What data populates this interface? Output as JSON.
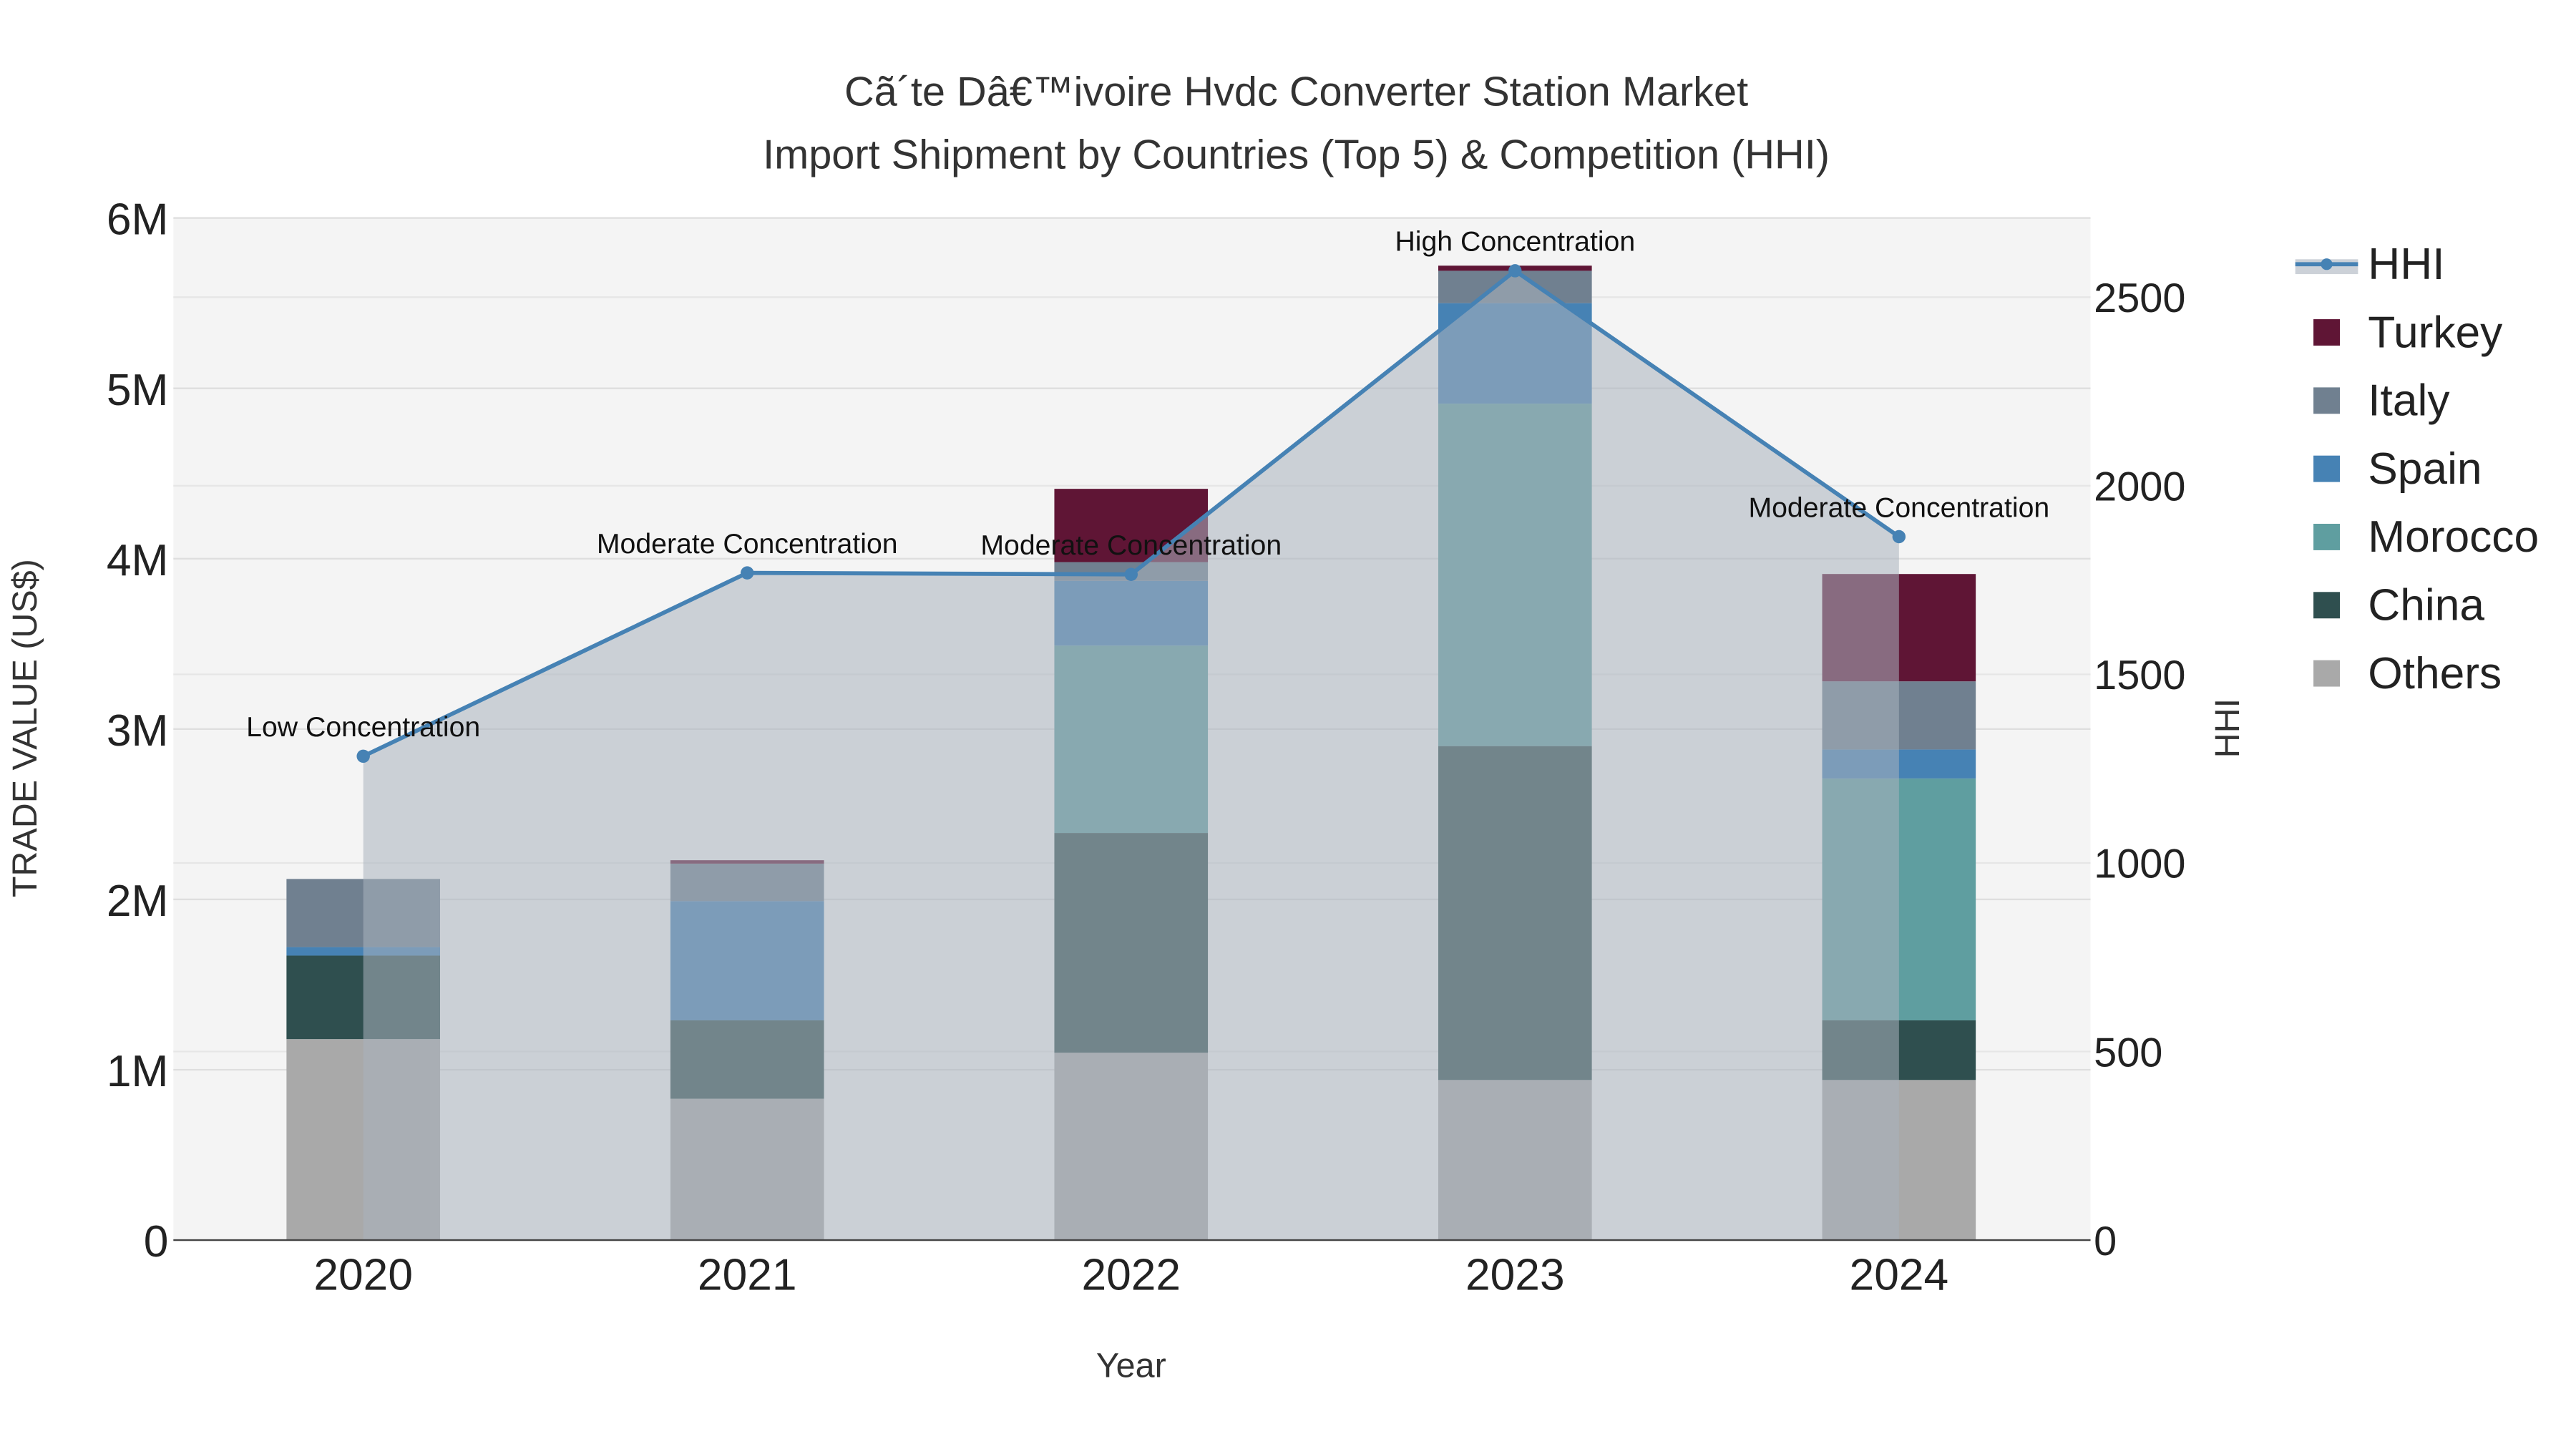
{
  "chart_data": {
    "type": "bar",
    "title": "Cã´te Dâ€™ivoire Hvdc Converter Station Market",
    "subtitle": "Import Shipment by Countries (Top 5) & Competition (HHI)",
    "xlabel": "Year",
    "ylabel": "TRADE VALUE (US$)",
    "y2label": "HHI",
    "categories": [
      "2020",
      "2021",
      "2022",
      "2023",
      "2024"
    ],
    "ylim": [
      0,
      6000000
    ],
    "y_ticks": [
      {
        "v": 0,
        "label": "0"
      },
      {
        "v": 1000000,
        "label": "1M"
      },
      {
        "v": 2000000,
        "label": "2M"
      },
      {
        "v": 3000000,
        "label": "3M"
      },
      {
        "v": 4000000,
        "label": "4M"
      },
      {
        "v": 5000000,
        "label": "5M"
      },
      {
        "v": 6000000,
        "label": "6M"
      }
    ],
    "y2lim": [
      0,
      2710
    ],
    "y2_ticks": [
      {
        "v": 0,
        "label": "0"
      },
      {
        "v": 500,
        "label": "500"
      },
      {
        "v": 1000,
        "label": "1000"
      },
      {
        "v": 1500,
        "label": "1500"
      },
      {
        "v": 2000,
        "label": "2000"
      },
      {
        "v": 2500,
        "label": "2500"
      }
    ],
    "stacked": true,
    "series": [
      {
        "name": "Others",
        "color": "#a9a9a9",
        "values": [
          1180000,
          830000,
          1100000,
          940000,
          940000
        ]
      },
      {
        "name": "China",
        "color": "#2f4f4f",
        "values": [
          490000,
          460000,
          1290000,
          1960000,
          350000
        ]
      },
      {
        "name": "Morocco",
        "color": "#5f9ea0",
        "values": [
          0,
          0,
          1100000,
          2010000,
          1420000
        ]
      },
      {
        "name": "Spain",
        "color": "#4682b4",
        "values": [
          50000,
          700000,
          380000,
          590000,
          170000
        ]
      },
      {
        "name": "Italy",
        "color": "#708090",
        "values": [
          400000,
          220000,
          110000,
          190000,
          400000
        ]
      },
      {
        "name": "Turkey",
        "color": "#5f1535",
        "values": [
          0,
          20000,
          430000,
          30000,
          630000
        ]
      }
    ],
    "hhi": {
      "name": "HHI",
      "color": "#4682b4",
      "values": [
        1283,
        1769,
        1765,
        2570,
        1865
      ],
      "annotations": [
        "Low Concentration",
        "Moderate Concentration",
        "Moderate Concentration",
        "High Concentration",
        "Moderate Concentration"
      ]
    },
    "legend_order": [
      "HHI",
      "Turkey",
      "Italy",
      "Spain",
      "Morocco",
      "China",
      "Others"
    ],
    "legend_placement": "right",
    "grid": true
  }
}
